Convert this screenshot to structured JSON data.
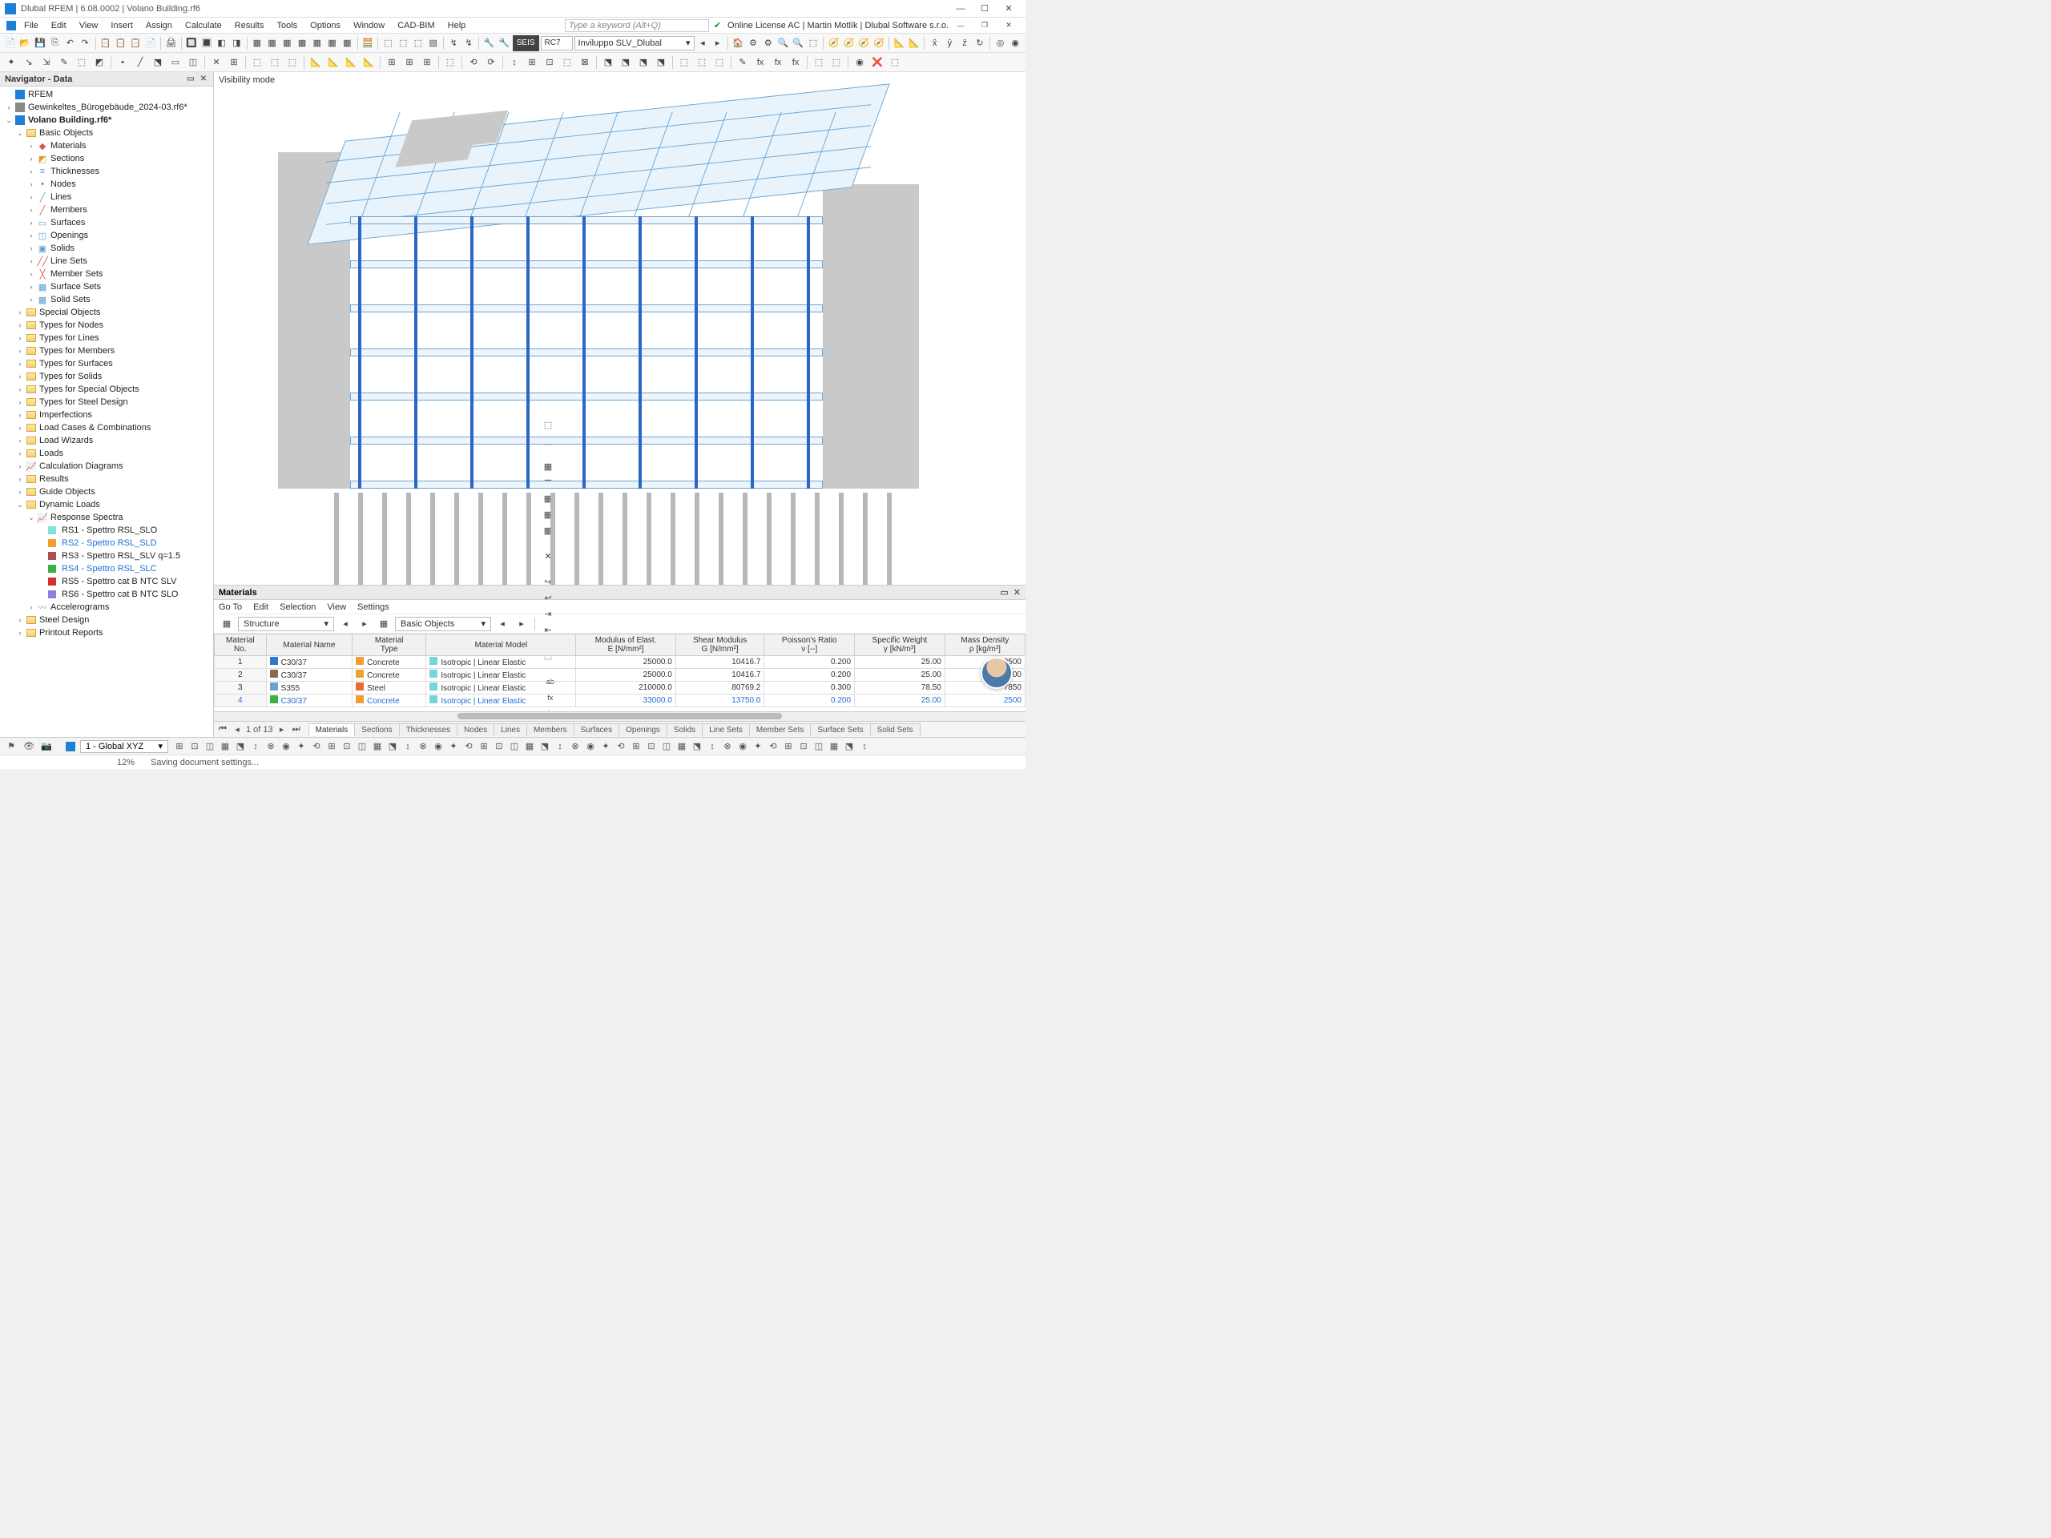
{
  "title": "Dlubal RFEM | 6.08.0002 | Volano Building.rf6",
  "menubar": [
    "File",
    "Edit",
    "View",
    "Insert",
    "Assign",
    "Calculate",
    "Results",
    "Tools",
    "Options",
    "Window",
    "CAD-BIM",
    "Help"
  ],
  "search_placeholder": "Type a keyword (Alt+Q)",
  "license_text": "Online License AC | Martin Motlík | Dlubal Software s.r.o.",
  "toolbar2": {
    "seis": "SEIS",
    "rc": "RC7",
    "combo": "Inviluppo SLV_Dlubal"
  },
  "navigator": {
    "title": "Navigator - Data",
    "root": "RFEM",
    "files": [
      "Gewinkeltes_Bürogebäude_2024-03.rf6*",
      "Volano Building.rf6*"
    ],
    "basic": {
      "label": "Basic Objects",
      "items": [
        "Materials",
        "Sections",
        "Thicknesses",
        "Nodes",
        "Lines",
        "Members",
        "Surfaces",
        "Openings",
        "Solids",
        "Line Sets",
        "Member Sets",
        "Surface Sets",
        "Solid Sets"
      ]
    },
    "folders": [
      "Special Objects",
      "Types for Nodes",
      "Types for Lines",
      "Types for Members",
      "Types for Surfaces",
      "Types for Solids",
      "Types for Special Objects",
      "Types for Steel Design",
      "Imperfections",
      "Load Cases & Combinations",
      "Load Wizards",
      "Loads",
      "Calculation Diagrams",
      "Results",
      "Guide Objects"
    ],
    "dynamic": {
      "label": "Dynamic Loads",
      "rs_label": "Response Spectra",
      "rs": [
        {
          "c": "#7fe3e3",
          "t": "RS1 - Spettro RSL_SLO"
        },
        {
          "c": "#f0a030",
          "t": "RS2 - Spettro RSL_SLD",
          "blue": true
        },
        {
          "c": "#a85050",
          "t": "RS3 - Spettro RSL_SLV q=1.5"
        },
        {
          "c": "#3cb043",
          "t": "RS4 - Spettro RSL_SLC",
          "blue": true
        },
        {
          "c": "#d23030",
          "t": "RS5 - Spettro cat B NTC SLV"
        },
        {
          "c": "#8a7fe3",
          "t": "RS6 - Spettro cat B NTC SLO"
        }
      ],
      "accel": "Accelerograms"
    },
    "bottom": [
      "Steel Design",
      "Printout Reports"
    ]
  },
  "viewport": {
    "label": "Visibility mode"
  },
  "materials": {
    "title": "Materials",
    "menu": [
      "Go To",
      "Edit",
      "Selection",
      "View",
      "Settings"
    ],
    "combo1": "Structure",
    "combo2": "Basic Objects",
    "headers": [
      "Material\nNo.",
      "Material Name",
      "Material\nType",
      "Material Model",
      "Modulus of Elast.\nE [N/mm²]",
      "Shear Modulus\nG [N/mm²]",
      "Poisson's Ratio\nν [--]",
      "Specific Weight\nγ [kN/m³]",
      "Mass Density\nρ [kg/m³]"
    ],
    "rows": [
      {
        "no": 1,
        "c": "#2b79d1",
        "name": "C30/37",
        "type": "Concrete",
        "model": "Isotropic | Linear Elastic",
        "c2": "#74d6d6",
        "c3": "#f0a030",
        "E": "25000.0",
        "G": "10416.7",
        "v": "0.200",
        "sw": "25.00",
        "md": "2500"
      },
      {
        "no": 2,
        "c": "#8a6a50",
        "name": "C30/37",
        "type": "Concrete",
        "model": "Isotropic | Linear Elastic",
        "c2": "#74d6d6",
        "c3": "#f0a030",
        "E": "25000.0",
        "G": "10416.7",
        "v": "0.200",
        "sw": "25.00",
        "md": "2500"
      },
      {
        "no": 3,
        "c": "#6aa0d6",
        "name": "S355",
        "type": "Steel",
        "model": "Isotropic | Linear Elastic",
        "c2": "#74d6d6",
        "c3": "#f06a30",
        "E": "210000.0",
        "G": "80769.2",
        "v": "0.300",
        "sw": "78.50",
        "md": "7850"
      },
      {
        "no": 4,
        "c": "#3cb043",
        "name": "C30/37",
        "type": "Concrete",
        "model": "Isotropic | Linear Elastic",
        "c2": "#74d6d6",
        "c3": "#f0a030",
        "E": "33000.0",
        "G": "13750.0",
        "v": "0.200",
        "sw": "25.00",
        "md": "2500",
        "blue": true
      }
    ],
    "pager": "1 of 13",
    "tabs": [
      "Materials",
      "Sections",
      "Thicknesses",
      "Nodes",
      "Lines",
      "Members",
      "Surfaces",
      "Openings",
      "Solids",
      "Line Sets",
      "Member Sets",
      "Surface Sets",
      "Solid Sets"
    ]
  },
  "statusbar": {
    "combo": "1 - Global XYZ"
  },
  "statusbar2": {
    "pct": "12%",
    "msg": "Saving document settings..."
  }
}
